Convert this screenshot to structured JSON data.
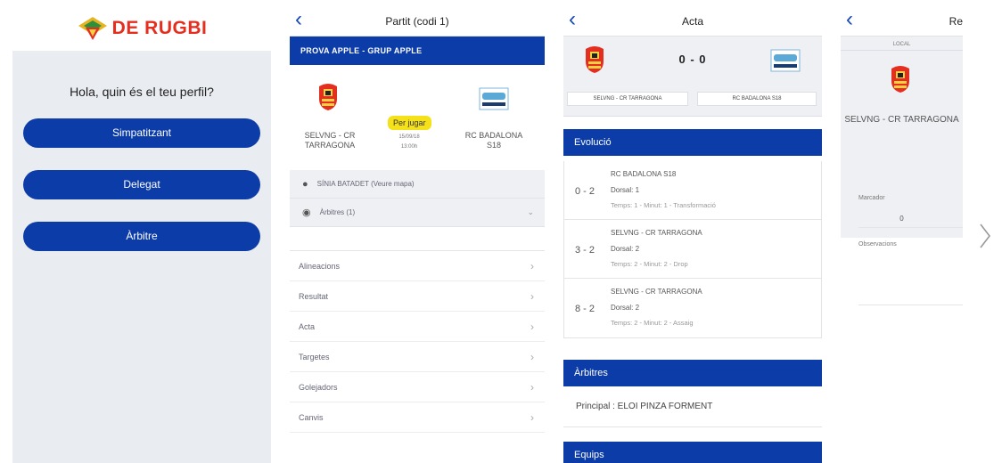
{
  "colors": {
    "brand_blue": "#0c3ca8",
    "logo_red": "#e42e1f",
    "status_yellow": "#f5e11a"
  },
  "screen1": {
    "logo_text": "DE RUGBI",
    "greeting": "Hola, quin és el teu perfil?",
    "buttons": [
      "Simpatitzant",
      "Delegat",
      "Àrbitre"
    ]
  },
  "screen2": {
    "title": "Partit (codi 1)",
    "band": "PROVA APPLE - GRUP APPLE",
    "status": "Per jugar",
    "date": "15/09/18",
    "time": "13:00h",
    "home": "SELVNG - CR TARRAGONA",
    "away": "RC BADALONA S18",
    "venue": "SÍNIA BATADET (Veure mapa)",
    "referees": "Àrbitres (1)",
    "menu": [
      "Alineacions",
      "Resultat",
      "Acta",
      "Targetes",
      "Golejadors",
      "Canvis"
    ]
  },
  "screen3": {
    "title": "Acta",
    "score": "0 - 0",
    "home": "SELVNG - CR TARRAGONA",
    "away": "RC BADALONA S18",
    "evolucio_title": "Evolució",
    "events": [
      {
        "score": "0 - 2",
        "team": "RC BADALONA S18",
        "dorsal": "Dorsal: 1",
        "detail": "Temps: 1 - Minut: 1 - Transformació"
      },
      {
        "score": "3 - 2",
        "team": "SELVNG - CR TARRAGONA",
        "dorsal": "Dorsal: 2",
        "detail": "Temps: 2 - Minut: 2 - Drop"
      },
      {
        "score": "8 - 2",
        "team": "SELVNG - CR TARRAGONA",
        "dorsal": "Dorsal: 2",
        "detail": "Temps: 2 - Minut: 2 - Assaig"
      }
    ],
    "arbitres_title": "Àrbitres",
    "principal": "Principal : ELOI PINZA FORMENT",
    "equips_title": "Equips"
  },
  "screen4": {
    "title": "Res",
    "local": "LOCAL",
    "team": "SELVNG - CR TARRAGONA",
    "marcador_label": "Marcador",
    "marcador_value": "0",
    "observacions": "Observacions"
  }
}
